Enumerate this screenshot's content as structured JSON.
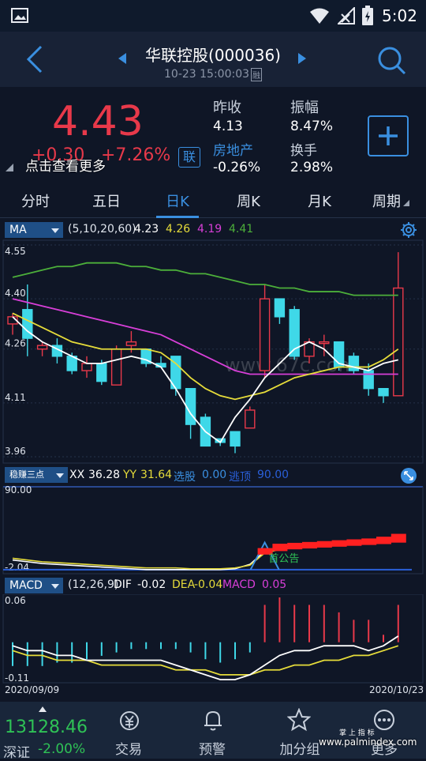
{
  "status": {
    "time": "5:02"
  },
  "header": {
    "title": "华联控股(000036)",
    "datetime": "10-23 15:00:03",
    "badge": "融"
  },
  "quote": {
    "price": "4.43",
    "change": "+0.30",
    "change_pct": "+7.26%",
    "tap_hint": "点击查看更多",
    "link_badge": "联",
    "prev_close_label": "昨收",
    "prev_close": "4.13",
    "amplitude_label": "振幅",
    "amplitude": "8.47%",
    "sector_label": "房地产",
    "sector_change": "-0.26%",
    "turnover_label": "换手",
    "turnover": "2.98%"
  },
  "tabs": [
    "分时",
    "五日",
    "日K",
    "周K",
    "月K",
    "周期"
  ],
  "ma_panel": {
    "selector": "MA",
    "params": "(5,10,20,60)",
    "ma5": "4.23",
    "ma10": "4.26",
    "ma20": "4.19",
    "ma60": "4.41",
    "y_ticks": [
      "4.55",
      "4.40",
      "4.26",
      "4.11",
      "3.96"
    ]
  },
  "xx_panel": {
    "selector": "稳赚三点",
    "xx_label": "XX",
    "xx": "36.28",
    "yy_label": "YY",
    "yy": "31.64",
    "xd_label": "选股",
    "xd": "0.00",
    "td_label": "逃顶",
    "td": "90.00",
    "y_top": "90.00",
    "y_bottom": "-2.04",
    "overlay_text": "首公告"
  },
  "macd_panel": {
    "selector": "MACD",
    "params": "(12,26,9)",
    "dif_label": "DIF",
    "dif": "-0.02",
    "dea_label": "DEA",
    "dea": "-0.04",
    "macd_label": "MACD",
    "macd": "0.05",
    "y_top": "0.06",
    "y_bottom": "-0.11",
    "date_start": "2020/09/09",
    "date_end": "2020/10/23"
  },
  "watermark": "www.67c.com",
  "bottom": {
    "index_value": "13128.46",
    "index_name": "深证",
    "index_change": "-2.00%",
    "nav": [
      "交易",
      "预警",
      "加分组",
      "更多"
    ],
    "footer_brand": "掌 上 指 标",
    "footer_url": "www.palmindex.com"
  },
  "colors": {
    "up": "#e8394a",
    "down": "#3fd8e8",
    "ma5": "#ffffff",
    "ma10": "#e6dc3a",
    "ma20": "#d83fd8",
    "ma60": "#4caf3a",
    "accent": "#3a8fe0"
  },
  "chart_data": [
    {
      "type": "candlestick",
      "title": "日K",
      "ylim": [
        3.96,
        4.55
      ],
      "ohlc": [
        [
          4.33,
          4.36,
          4.3,
          4.35
        ],
        [
          4.37,
          4.44,
          4.24,
          4.29
        ],
        [
          4.26,
          4.28,
          4.24,
          4.27
        ],
        [
          4.27,
          4.29,
          4.22,
          4.24
        ],
        [
          4.24,
          4.25,
          4.19,
          4.2
        ],
        [
          4.2,
          4.24,
          4.18,
          4.22
        ],
        [
          4.22,
          4.23,
          4.16,
          4.17
        ],
        [
          4.16,
          4.27,
          4.16,
          4.26
        ],
        [
          4.27,
          4.31,
          4.25,
          4.28
        ],
        [
          4.26,
          4.26,
          4.21,
          4.22
        ],
        [
          4.22,
          4.24,
          4.21,
          4.21
        ],
        [
          4.24,
          4.24,
          4.13,
          4.15
        ],
        [
          4.15,
          4.15,
          4.01,
          4.05
        ],
        [
          4.07,
          4.08,
          3.99,
          3.99
        ],
        [
          4.01,
          4.01,
          3.99,
          4.0
        ],
        [
          4.03,
          4.03,
          3.97,
          3.99
        ],
        [
          4.04,
          4.1,
          4.04,
          4.09
        ],
        [
          4.2,
          4.44,
          4.18,
          4.4
        ],
        [
          4.4,
          4.4,
          4.33,
          4.35
        ],
        [
          4.37,
          4.38,
          4.23,
          4.24
        ],
        [
          4.24,
          4.29,
          4.22,
          4.28
        ],
        [
          4.28,
          4.3,
          4.24,
          4.28
        ],
        [
          4.28,
          4.28,
          4.2,
          4.21
        ],
        [
          4.24,
          4.25,
          4.19,
          4.2
        ],
        [
          4.2,
          4.22,
          4.13,
          4.15
        ],
        [
          4.15,
          4.15,
          4.11,
          4.13
        ],
        [
          4.13,
          4.53,
          4.13,
          4.43
        ]
      ],
      "ma5": [
        4.35,
        4.31,
        4.28,
        4.26,
        4.24,
        4.22,
        4.22,
        4.23,
        4.24,
        4.23,
        4.21,
        4.15,
        4.08,
        4.03,
        4.0,
        4.07,
        4.12,
        4.18,
        4.22,
        4.26,
        4.28,
        4.26,
        4.22,
        4.21,
        4.2,
        4.22,
        4.23
      ],
      "ma10": [
        4.36,
        4.34,
        4.32,
        4.3,
        4.28,
        4.27,
        4.26,
        4.26,
        4.26,
        4.26,
        4.25,
        4.22,
        4.18,
        4.15,
        4.13,
        4.12,
        4.13,
        4.14,
        4.16,
        4.18,
        4.19,
        4.2,
        4.21,
        4.21,
        4.21,
        4.23,
        4.26
      ],
      "ma20": [
        4.4,
        4.39,
        4.38,
        4.37,
        4.36,
        4.35,
        4.34,
        4.33,
        4.32,
        4.31,
        4.3,
        4.28,
        4.26,
        4.24,
        4.22,
        4.2,
        4.19,
        4.19,
        4.19,
        4.19,
        4.19,
        4.19,
        4.19,
        4.19,
        4.19,
        4.19,
        4.19
      ],
      "ma60": [
        4.46,
        4.47,
        4.48,
        4.49,
        4.49,
        4.5,
        4.5,
        4.5,
        4.49,
        4.49,
        4.48,
        4.48,
        4.47,
        4.47,
        4.46,
        4.45,
        4.44,
        4.44,
        4.43,
        4.43,
        4.42,
        4.42,
        4.42,
        4.41,
        4.41,
        4.41,
        4.41
      ]
    },
    {
      "type": "line",
      "title": "稳赚三点",
      "ylim": [
        -2.04,
        90.0
      ],
      "xx": [
        10,
        8,
        6,
        5,
        4,
        3,
        2,
        1,
        0,
        -1,
        -1,
        -1,
        -1,
        -1,
        -1,
        0,
        5,
        20,
        25,
        26,
        27,
        28,
        29,
        30,
        31,
        33,
        36.28
      ],
      "yy": [
        12,
        10,
        8,
        7,
        6,
        5,
        4,
        3,
        2,
        1,
        1,
        1,
        0,
        0,
        0,
        1,
        4,
        18,
        22,
        24,
        25,
        26,
        27,
        28,
        29,
        30,
        31.64
      ]
    },
    {
      "type": "bar",
      "title": "MACD",
      "ylim": [
        -0.11,
        0.06
      ],
      "macd": [
        -0.07,
        -0.07,
        -0.07,
        -0.06,
        -0.06,
        -0.05,
        -0.04,
        -0.03,
        -0.02,
        -0.02,
        -0.02,
        -0.02,
        -0.03,
        -0.05,
        -0.06,
        -0.05,
        -0.03,
        0.05,
        0.06,
        0.05,
        0.05,
        0.05,
        0.04,
        0.03,
        0.03,
        0.01,
        0.05
      ],
      "dif": [
        -0.04,
        -0.05,
        -0.05,
        -0.06,
        -0.06,
        -0.07,
        -0.07,
        -0.07,
        -0.07,
        -0.07,
        -0.07,
        -0.08,
        -0.09,
        -0.1,
        -0.11,
        -0.11,
        -0.1,
        -0.08,
        -0.06,
        -0.05,
        -0.05,
        -0.04,
        -0.04,
        -0.04,
        -0.05,
        -0.04,
        -0.02
      ],
      "dea": [
        -0.05,
        -0.06,
        -0.06,
        -0.07,
        -0.07,
        -0.07,
        -0.08,
        -0.08,
        -0.08,
        -0.08,
        -0.08,
        -0.09,
        -0.09,
        -0.09,
        -0.1,
        -0.1,
        -0.1,
        -0.09,
        -0.09,
        -0.08,
        -0.08,
        -0.07,
        -0.07,
        -0.06,
        -0.06,
        -0.05,
        -0.04
      ]
    }
  ]
}
